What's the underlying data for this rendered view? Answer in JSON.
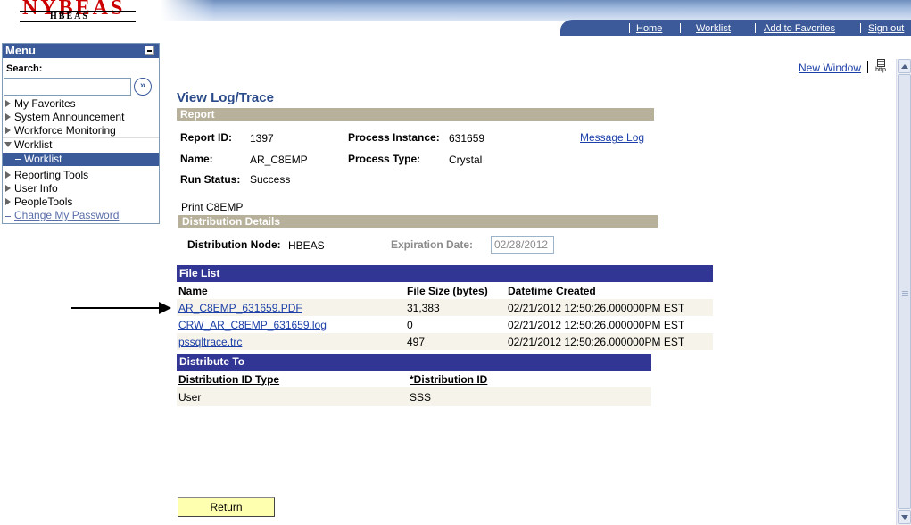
{
  "header": {
    "logo_big": "NYBEAS",
    "logo_small": "HBEAS",
    "nav": [
      "Home",
      "Worklist",
      "Add to Favorites",
      "Sign out"
    ]
  },
  "menu": {
    "title": "Menu",
    "search_label": "Search:",
    "search_value": "",
    "search_go": "»",
    "items": [
      {
        "label": "My Favorites",
        "state": "collapsed"
      },
      {
        "label": "System Announcement",
        "state": "collapsed"
      },
      {
        "label": "Workforce Monitoring",
        "state": "collapsed"
      },
      {
        "label": "Worklist",
        "state": "expanded"
      },
      {
        "label": "Worklist",
        "state": "selected"
      },
      {
        "label": "Reporting Tools",
        "state": "collapsed"
      },
      {
        "label": "User Info",
        "state": "collapsed"
      },
      {
        "label": "PeopleTools",
        "state": "collapsed"
      },
      {
        "label": "Change My Password",
        "state": "link"
      }
    ]
  },
  "toolbar": {
    "new_window": "New Window",
    "http_icon_text": "http"
  },
  "page": {
    "title": "View Log/Trace",
    "report_section": "Report",
    "report_id_label": "Report ID:",
    "report_id": "1397",
    "process_instance_label": "Process Instance:",
    "process_instance": "631659",
    "message_log": "Message Log",
    "name_label": "Name:",
    "name": "AR_C8EMP",
    "process_type_label": "Process Type:",
    "process_type": "Crystal",
    "run_status_label": "Run Status:",
    "run_status": "Success",
    "description": "Print C8EMP",
    "distribution_section": "Distribution Details",
    "distribution_node_label": "Distribution Node:",
    "distribution_node": "HBEAS",
    "expiration_date_label": "Expiration Date:",
    "expiration_date": "02/28/2012",
    "file_list": {
      "title": "File List",
      "columns": [
        "Name",
        "File Size (bytes)",
        "Datetime Created"
      ],
      "rows": [
        {
          "name": "AR_C8EMP_631659.PDF",
          "size": "31,383",
          "datetime": "02/21/2012 12:50:26.000000PM EST"
        },
        {
          "name": "CRW_AR_C8EMP_631659.log",
          "size": "0",
          "datetime": "02/21/2012 12:50:26.000000PM EST"
        },
        {
          "name": "pssqltrace.trc",
          "size": "497",
          "datetime": "02/21/2012 12:50:26.000000PM EST"
        }
      ]
    },
    "distribute_to": {
      "title": "Distribute To",
      "columns": [
        "Distribution ID Type",
        "*Distribution ID"
      ],
      "rows": [
        {
          "type": "User",
          "id": "SSS"
        }
      ]
    },
    "return_button": "Return"
  },
  "colors": {
    "nav_blue": "#3c5a9a",
    "section_tan": "#b7b09a",
    "grid_header_blue": "#313694",
    "link_blue": "#1c3fa8",
    "button_yellow": "#ffffb0"
  }
}
